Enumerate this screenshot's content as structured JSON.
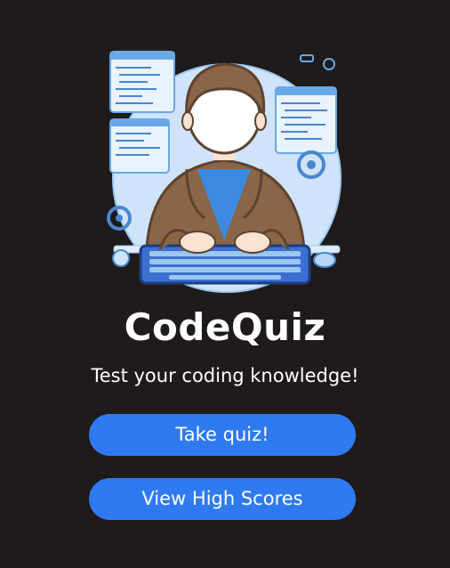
{
  "app": {
    "title": "CodeQuiz",
    "tagline": "Test your coding knowledge!"
  },
  "hero": {
    "icon": "developer-at-keyboard-illustration"
  },
  "actions": {
    "take_quiz_label": "Take quiz!",
    "view_scores_label": "View High Scores"
  },
  "colors": {
    "background": "#1f1b1b",
    "accent": "#2f7af0",
    "text": "#ffffff"
  }
}
